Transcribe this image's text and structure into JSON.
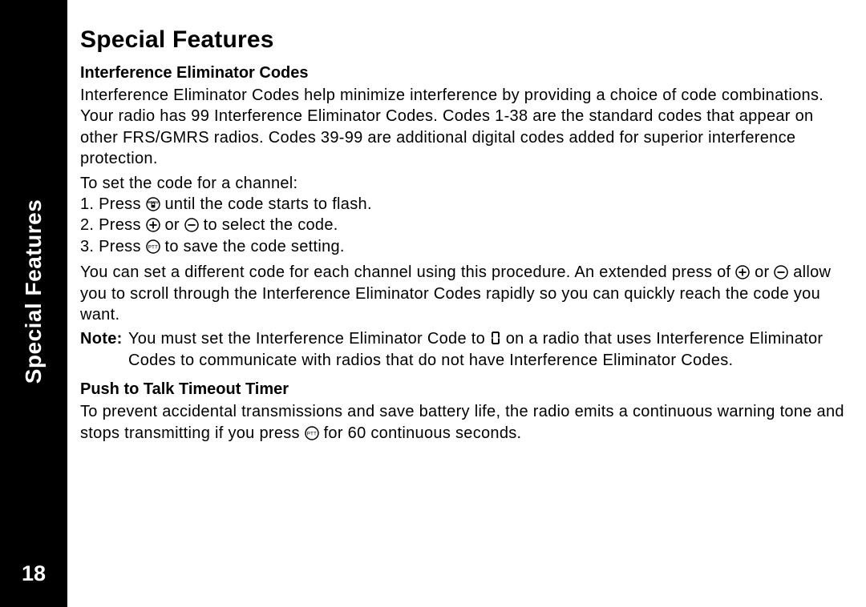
{
  "sidebar": {
    "label": "Special Features",
    "page_number": "18"
  },
  "title": "Special Features",
  "section1": {
    "heading": "Interference Eliminator Codes",
    "intro": "Interference Eliminator Codes help minimize interference by providing a choice of code combinations. Your radio has 99 Interference Eliminator Codes. Codes 1-38 are the standard codes that appear on other FRS/GMRS radios. Codes 39-99 are additional digital codes added for superior interference protection.",
    "lead": "To set the code for a channel:",
    "step1_prefix": "1. Press ",
    "step1_suffix": " until the code starts to flash.",
    "step2_prefix": "2. Press ",
    "step2_mid": " or ",
    "step2_suffix": " to select the code.",
    "step3_prefix": "3. Press ",
    "step3_suffix": " to save the code setting.",
    "after_a": "You can set a different code for each channel using this procedure. An extended press of ",
    "after_mid": " or ",
    "after_b": " allow you to scroll through the Interference Eliminator Codes rapidly so you can quickly reach the code you want.",
    "note_label": "Note:",
    "note_a": " You must set the Interference Eliminator Code to ",
    "note_b": " on a radio that uses Interference Eliminator Codes to communicate with radios that do not have Interference Eliminator Codes.",
    "zero_digit": "0"
  },
  "section2": {
    "heading": "Push to Talk Timeout Timer",
    "body_a": "To prevent accidental transmissions and save battery life, the radio emits a continuous warning tone and stops transmitting if you press ",
    "body_b": " for 60 continuous seconds."
  },
  "icons": {
    "menu": "menu-lock-icon",
    "plus": "plus-circle-icon",
    "minus": "minus-circle-icon",
    "ptt": "ptt-circle-icon"
  }
}
